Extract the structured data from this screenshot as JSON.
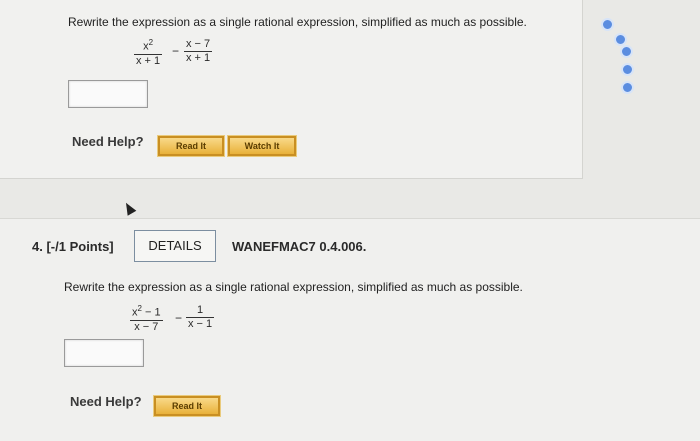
{
  "q3": {
    "prompt": "Rewrite the expression as a single rational expression, simplified as much as possible.",
    "frac1_num": "x",
    "frac1_num_exp": "2",
    "frac1_den": "x + 1",
    "operator": "−",
    "frac2_num": "x − 7",
    "frac2_den": "x + 1",
    "need_help": "Need Help?",
    "read_it": "Read It",
    "watch_it": "Watch It"
  },
  "q4": {
    "number": "4.",
    "points": "[-/1 Points]",
    "details": "DETAILS",
    "code": "WANEFMAC7 0.4.006.",
    "prompt": "Rewrite the expression as a single rational expression, simplified as much as possible.",
    "frac1_num_base": "x",
    "frac1_num_exp": "2",
    "frac1_num_rest": " − 1",
    "frac1_den": "x − 7",
    "operator": "−",
    "frac2_num": "1",
    "frac2_den": "x − 1",
    "need_help": "Need Help?",
    "read_it": "Read It"
  },
  "colors": {
    "button_fill": "#e9b13a",
    "nav_dot": "#5b8de0"
  },
  "icons": [
    "mouse-cursor-icon",
    "nav-dot-icon"
  ]
}
